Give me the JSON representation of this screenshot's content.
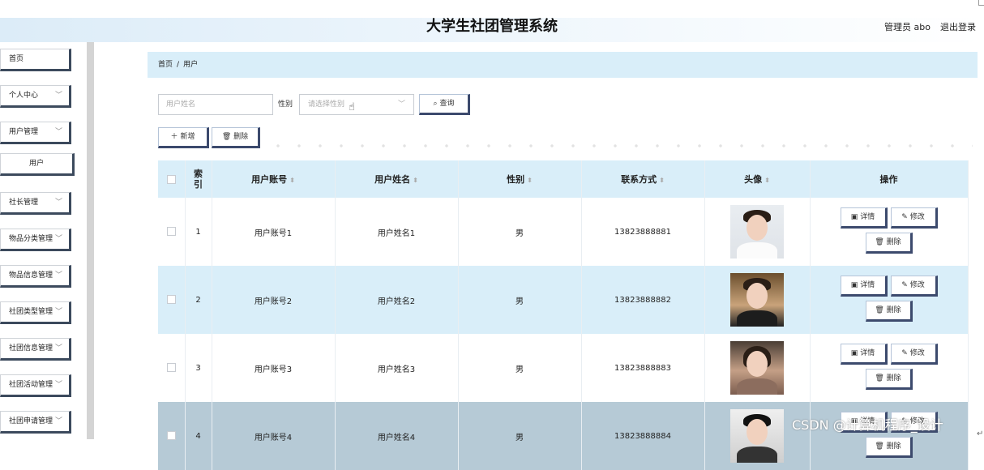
{
  "header": {
    "app_title": "大学生社团管理系统",
    "user": "管理员 abo",
    "logout": "退出登录"
  },
  "sidebar": {
    "items": [
      {
        "label": "首页",
        "chevron": false
      },
      {
        "label": "个人中心",
        "chevron": true
      },
      {
        "label": "用户管理",
        "chevron": true
      },
      {
        "label": "用户",
        "chevron": false,
        "sub": true
      },
      {
        "label": "社长管理",
        "chevron": true
      },
      {
        "label": "物品分类管理",
        "chevron": true
      },
      {
        "label": "物品信息管理",
        "chevron": true
      },
      {
        "label": "社团类型管理",
        "chevron": true
      },
      {
        "label": "社团信息管理",
        "chevron": true
      },
      {
        "label": "社团活动管理",
        "chevron": true
      },
      {
        "label": "社团申请管理",
        "chevron": true
      }
    ]
  },
  "breadcrumb": {
    "home": "首页",
    "sep": "/",
    "current": "用户"
  },
  "search": {
    "name_placeholder": "用户姓名",
    "gender_label": "性别",
    "gender_placeholder": "请选择性别",
    "query_label": "查询"
  },
  "actions": {
    "add_label": "新增",
    "delete_label": "删除"
  },
  "table": {
    "headers": {
      "index": "索引",
      "account": "用户账号",
      "name": "用户姓名",
      "gender": "性别",
      "phone": "联系方式",
      "avatar": "头像",
      "ops": "操作"
    },
    "rows": [
      {
        "index": "1",
        "account": "用户账号1",
        "name": "用户姓名1",
        "gender": "男",
        "phone": "13823888881"
      },
      {
        "index": "2",
        "account": "用户账号2",
        "name": "用户姓名2",
        "gender": "男",
        "phone": "13823888882"
      },
      {
        "index": "3",
        "account": "用户账号3",
        "name": "用户姓名3",
        "gender": "男",
        "phone": "13823888883"
      },
      {
        "index": "4",
        "account": "用户账号4",
        "name": "用户姓名4",
        "gender": "男",
        "phone": "13823888884"
      }
    ],
    "op_labels": {
      "detail": "详情",
      "edit": "修改",
      "remove": "删除"
    }
  },
  "watermark": "CSDN @计算机程序_设计",
  "colors": {
    "accent": "#d9eef9",
    "button_shadow": "#3c4a6d",
    "dim_row": "#b6cad6"
  }
}
